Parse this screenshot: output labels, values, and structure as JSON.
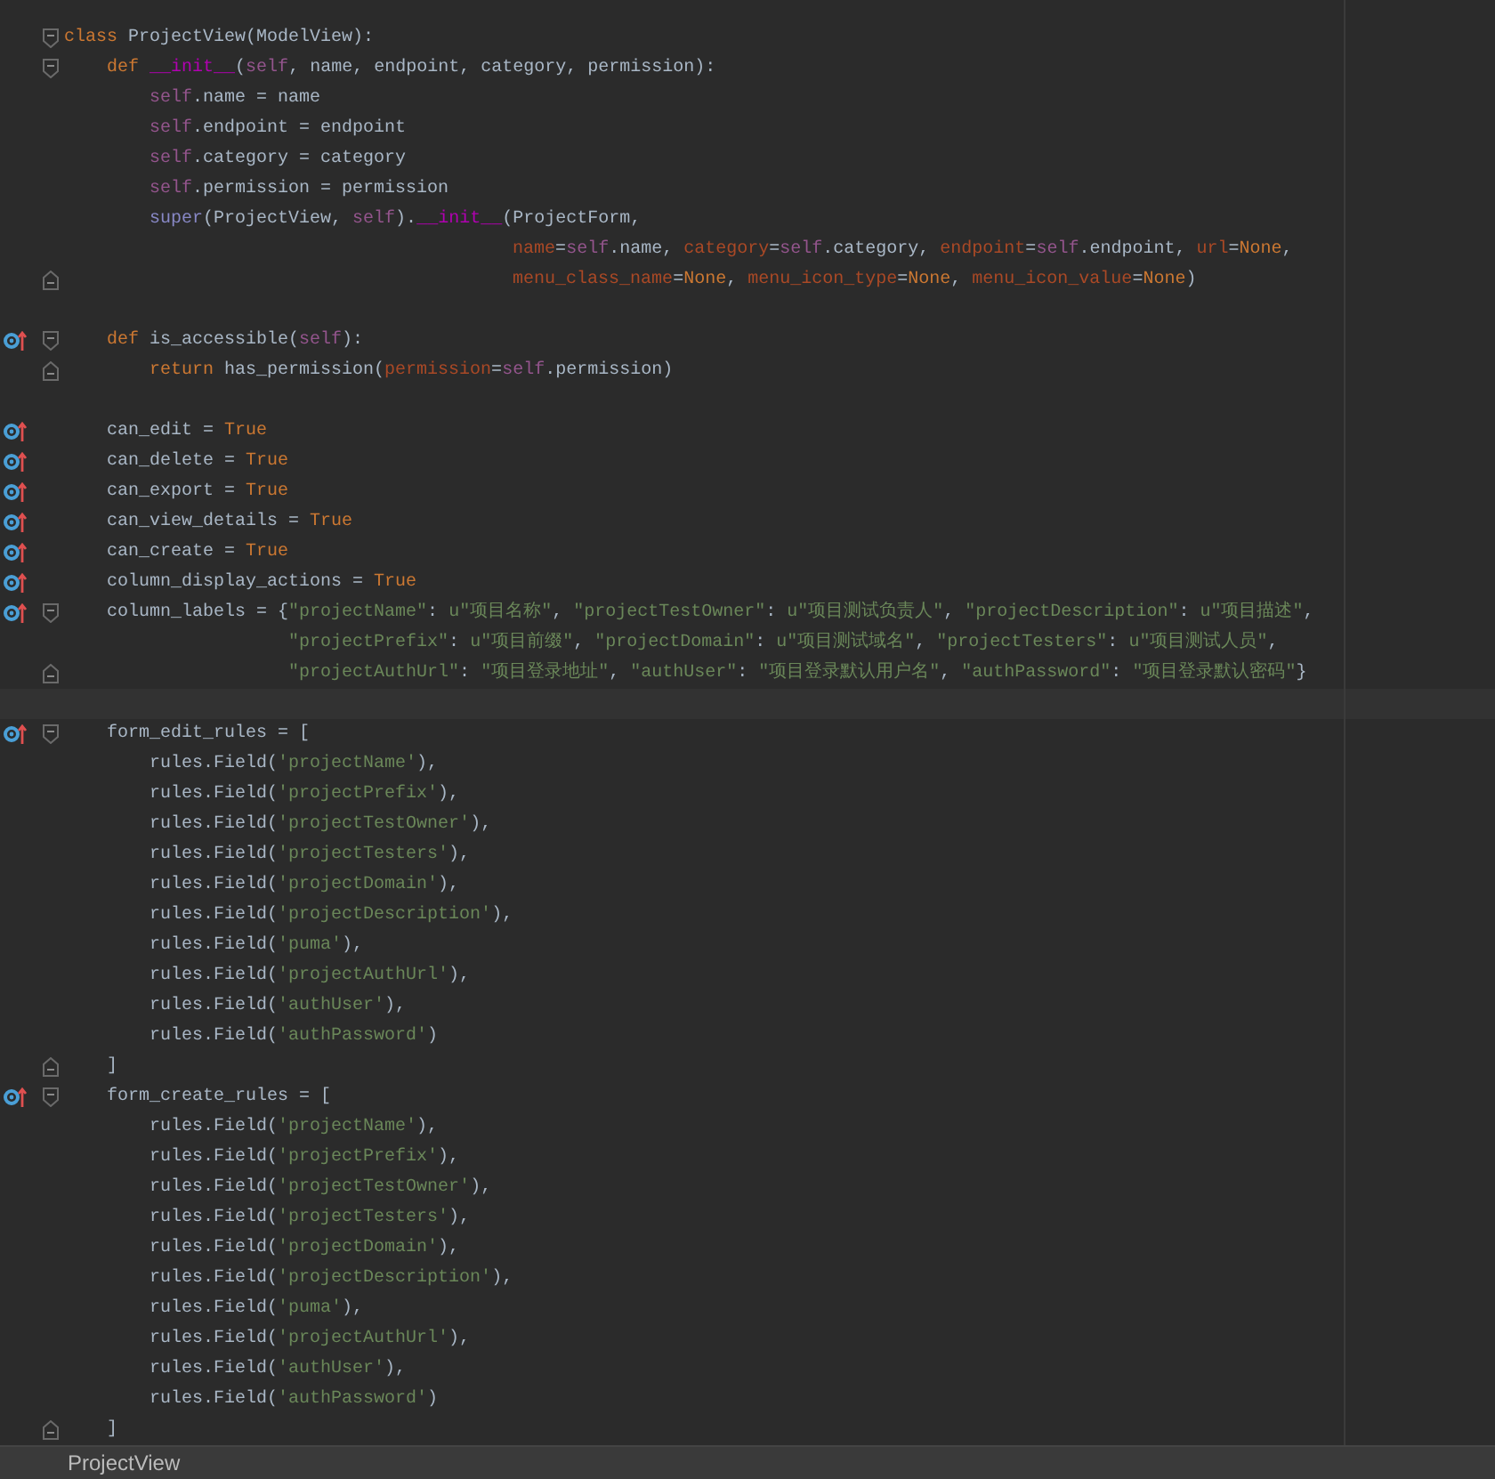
{
  "editor": {
    "lines": [
      {
        "fold_start": true,
        "tokens": [
          {
            "kind": "keyword",
            "text": "class"
          },
          {
            "kind": "plain",
            "text": " ProjectView(ModelView):"
          }
        ]
      },
      {
        "fold_start": true,
        "tokens": [
          {
            "kind": "keyword",
            "text": "    def "
          },
          {
            "kind": "magic",
            "text": "__init__"
          },
          {
            "kind": "plain",
            "text": "("
          },
          {
            "kind": "self",
            "text": "self"
          },
          {
            "kind": "plain",
            "text": ", name, endpoint, category, permission):"
          }
        ]
      },
      {
        "tokens": [
          {
            "kind": "self",
            "text": "        self"
          },
          {
            "kind": "plain",
            "text": ".name = name"
          }
        ]
      },
      {
        "tokens": [
          {
            "kind": "self",
            "text": "        self"
          },
          {
            "kind": "plain",
            "text": ".endpoint = endpoint"
          }
        ]
      },
      {
        "tokens": [
          {
            "kind": "self",
            "text": "        self"
          },
          {
            "kind": "plain",
            "text": ".category = category"
          }
        ]
      },
      {
        "tokens": [
          {
            "kind": "self",
            "text": "        self"
          },
          {
            "kind": "plain",
            "text": ".permission = permission"
          }
        ]
      },
      {
        "tokens": [
          {
            "kind": "builtin",
            "text": "        super"
          },
          {
            "kind": "plain",
            "text": "(ProjectView, "
          },
          {
            "kind": "self",
            "text": "self"
          },
          {
            "kind": "plain",
            "text": ")."
          },
          {
            "kind": "magic",
            "text": "__init__"
          },
          {
            "kind": "plain",
            "text": "(ProjectForm,"
          }
        ]
      },
      {
        "tokens": [
          {
            "kind": "param",
            "text": "                                          name"
          },
          {
            "kind": "plain",
            "text": "="
          },
          {
            "kind": "self",
            "text": "self"
          },
          {
            "kind": "plain",
            "text": ".name, "
          },
          {
            "kind": "param",
            "text": "category"
          },
          {
            "kind": "plain",
            "text": "="
          },
          {
            "kind": "self",
            "text": "self"
          },
          {
            "kind": "plain",
            "text": ".category, "
          },
          {
            "kind": "param",
            "text": "endpoint"
          },
          {
            "kind": "plain",
            "text": "="
          },
          {
            "kind": "self",
            "text": "self"
          },
          {
            "kind": "plain",
            "text": ".endpoint, "
          },
          {
            "kind": "param",
            "text": "url"
          },
          {
            "kind": "plain",
            "text": "="
          },
          {
            "kind": "keyword",
            "text": "None"
          },
          {
            "kind": "plain",
            "text": ","
          }
        ]
      },
      {
        "fold_end": true,
        "tokens": [
          {
            "kind": "param",
            "text": "                                          menu_class_name"
          },
          {
            "kind": "plain",
            "text": "="
          },
          {
            "kind": "keyword",
            "text": "None"
          },
          {
            "kind": "plain",
            "text": ", "
          },
          {
            "kind": "param",
            "text": "menu_icon_type"
          },
          {
            "kind": "plain",
            "text": "="
          },
          {
            "kind": "keyword",
            "text": "None"
          },
          {
            "kind": "plain",
            "text": ", "
          },
          {
            "kind": "param",
            "text": "menu_icon_value"
          },
          {
            "kind": "plain",
            "text": "="
          },
          {
            "kind": "keyword",
            "text": "None"
          },
          {
            "kind": "plain",
            "text": ")"
          }
        ]
      },
      {
        "kind": "blank"
      },
      {
        "override_marker": true,
        "fold_start": true,
        "tokens": [
          {
            "kind": "keyword",
            "text": "    def"
          },
          {
            "kind": "plain",
            "text": " is_accessible("
          },
          {
            "kind": "self",
            "text": "self"
          },
          {
            "kind": "plain",
            "text": "):"
          }
        ]
      },
      {
        "fold_end": true,
        "tokens": [
          {
            "kind": "keyword",
            "text": "        return"
          },
          {
            "kind": "plain",
            "text": " has_permission("
          },
          {
            "kind": "param",
            "text": "permission"
          },
          {
            "kind": "plain",
            "text": "="
          },
          {
            "kind": "self",
            "text": "self"
          },
          {
            "kind": "plain",
            "text": ".permission)"
          }
        ]
      },
      {
        "kind": "blank"
      },
      {
        "override_marker": true,
        "tokens": [
          {
            "kind": "plain",
            "text": "    can_edit = "
          },
          {
            "kind": "keyword",
            "text": "True"
          }
        ]
      },
      {
        "override_marker": true,
        "tokens": [
          {
            "kind": "plain",
            "text": "    can_delete = "
          },
          {
            "kind": "keyword",
            "text": "True"
          }
        ]
      },
      {
        "override_marker": true,
        "tokens": [
          {
            "kind": "plain",
            "text": "    can_export = "
          },
          {
            "kind": "keyword",
            "text": "True"
          }
        ]
      },
      {
        "override_marker": true,
        "tokens": [
          {
            "kind": "plain",
            "text": "    can_view_details = "
          },
          {
            "kind": "keyword",
            "text": "True"
          }
        ]
      },
      {
        "override_marker": true,
        "tokens": [
          {
            "kind": "plain",
            "text": "    can_create = "
          },
          {
            "kind": "keyword",
            "text": "True"
          }
        ]
      },
      {
        "override_marker": true,
        "tokens": [
          {
            "kind": "plain",
            "text": "    column_display_actions = "
          },
          {
            "kind": "keyword",
            "text": "True"
          }
        ]
      },
      {
        "override_marker": true,
        "fold_start": true,
        "tokens": [
          {
            "kind": "plain",
            "text": "    column_labels = {"
          },
          {
            "kind": "string",
            "text": "\"projectName\""
          },
          {
            "kind": "plain",
            "text": ": "
          },
          {
            "kind": "string",
            "text": "u\"项目名称\""
          },
          {
            "kind": "plain",
            "text": ", "
          },
          {
            "kind": "string",
            "text": "\"projectTestOwner\""
          },
          {
            "kind": "plain",
            "text": ": "
          },
          {
            "kind": "string",
            "text": "u\"项目测试负责人\""
          },
          {
            "kind": "plain",
            "text": ", "
          },
          {
            "kind": "string",
            "text": "\"projectDescription\""
          },
          {
            "kind": "plain",
            "text": ": "
          },
          {
            "kind": "string",
            "text": "u\"项目描述\""
          },
          {
            "kind": "plain",
            "text": ","
          }
        ]
      },
      {
        "tokens": [
          {
            "kind": "string",
            "text": "                     \"projectPrefix\""
          },
          {
            "kind": "plain",
            "text": ": "
          },
          {
            "kind": "string",
            "text": "u\"项目前缀\""
          },
          {
            "kind": "plain",
            "text": ", "
          },
          {
            "kind": "string",
            "text": "\"projectDomain\""
          },
          {
            "kind": "plain",
            "text": ": "
          },
          {
            "kind": "string",
            "text": "u\"项目测试域名\""
          },
          {
            "kind": "plain",
            "text": ", "
          },
          {
            "kind": "string",
            "text": "\"projectTesters\""
          },
          {
            "kind": "plain",
            "text": ": "
          },
          {
            "kind": "string",
            "text": "u\"项目测试人员\""
          },
          {
            "kind": "plain",
            "text": ","
          }
        ]
      },
      {
        "fold_end": true,
        "tokens": [
          {
            "kind": "string",
            "text": "                     \"projectAuthUrl\""
          },
          {
            "kind": "plain",
            "text": ": "
          },
          {
            "kind": "string",
            "text": "\"项目登录地址\""
          },
          {
            "kind": "plain",
            "text": ", "
          },
          {
            "kind": "string",
            "text": "\"authUser\""
          },
          {
            "kind": "plain",
            "text": ": "
          },
          {
            "kind": "string",
            "text": "\"项目登录默认用户名\""
          },
          {
            "kind": "plain",
            "text": ", "
          },
          {
            "kind": "string",
            "text": "\"authPassword\""
          },
          {
            "kind": "plain",
            "text": ": "
          },
          {
            "kind": "string",
            "text": "\"项目登录默认密码\""
          },
          {
            "kind": "plain",
            "text": "}"
          }
        ]
      },
      {
        "current": true
      },
      {
        "override_marker": true,
        "fold_start": true,
        "tokens": [
          {
            "kind": "plain",
            "text": "    form_edit_rules = ["
          }
        ]
      },
      {
        "tokens": [
          {
            "kind": "plain",
            "text": "        rules.Field("
          },
          {
            "kind": "string",
            "text": "'projectName'"
          },
          {
            "kind": "plain",
            "text": "),"
          }
        ]
      },
      {
        "tokens": [
          {
            "kind": "plain",
            "text": "        rules.Field("
          },
          {
            "kind": "string",
            "text": "'projectPrefix'"
          },
          {
            "kind": "plain",
            "text": "),"
          }
        ]
      },
      {
        "tokens": [
          {
            "kind": "plain",
            "text": "        rules.Field("
          },
          {
            "kind": "string",
            "text": "'projectTestOwner'"
          },
          {
            "kind": "plain",
            "text": "),"
          }
        ]
      },
      {
        "tokens": [
          {
            "kind": "plain",
            "text": "        rules.Field("
          },
          {
            "kind": "string",
            "text": "'projectTesters'"
          },
          {
            "kind": "plain",
            "text": "),"
          }
        ]
      },
      {
        "tokens": [
          {
            "kind": "plain",
            "text": "        rules.Field("
          },
          {
            "kind": "string",
            "text": "'projectDomain'"
          },
          {
            "kind": "plain",
            "text": "),"
          }
        ]
      },
      {
        "tokens": [
          {
            "kind": "plain",
            "text": "        rules.Field("
          },
          {
            "kind": "string",
            "text": "'projectDescription'"
          },
          {
            "kind": "plain",
            "text": "),"
          }
        ]
      },
      {
        "tokens": [
          {
            "kind": "plain",
            "text": "        rules.Field("
          },
          {
            "kind": "string",
            "text": "'puma'"
          },
          {
            "kind": "plain",
            "text": "),"
          }
        ]
      },
      {
        "tokens": [
          {
            "kind": "plain",
            "text": "        rules.Field("
          },
          {
            "kind": "string",
            "text": "'projectAuthUrl'"
          },
          {
            "kind": "plain",
            "text": "),"
          }
        ]
      },
      {
        "tokens": [
          {
            "kind": "plain",
            "text": "        rules.Field("
          },
          {
            "kind": "string",
            "text": "'authUser'"
          },
          {
            "kind": "plain",
            "text": "),"
          }
        ]
      },
      {
        "tokens": [
          {
            "kind": "plain",
            "text": "        rules.Field("
          },
          {
            "kind": "string",
            "text": "'authPassword'"
          },
          {
            "kind": "plain",
            "text": ")"
          }
        ]
      },
      {
        "fold_end": true,
        "tokens": [
          {
            "kind": "plain",
            "text": "    ]"
          }
        ]
      },
      {
        "override_marker": true,
        "fold_start": true,
        "tokens": [
          {
            "kind": "plain",
            "text": "    form_create_rules = ["
          }
        ]
      },
      {
        "tokens": [
          {
            "kind": "plain",
            "text": "        rules.Field("
          },
          {
            "kind": "string",
            "text": "'projectName'"
          },
          {
            "kind": "plain",
            "text": "),"
          }
        ]
      },
      {
        "tokens": [
          {
            "kind": "plain",
            "text": "        rules.Field("
          },
          {
            "kind": "string",
            "text": "'projectPrefix'"
          },
          {
            "kind": "plain",
            "text": "),"
          }
        ]
      },
      {
        "tokens": [
          {
            "kind": "plain",
            "text": "        rules.Field("
          },
          {
            "kind": "string",
            "text": "'projectTestOwner'"
          },
          {
            "kind": "plain",
            "text": "),"
          }
        ]
      },
      {
        "tokens": [
          {
            "kind": "plain",
            "text": "        rules.Field("
          },
          {
            "kind": "string",
            "text": "'projectTesters'"
          },
          {
            "kind": "plain",
            "text": "),"
          }
        ]
      },
      {
        "tokens": [
          {
            "kind": "plain",
            "text": "        rules.Field("
          },
          {
            "kind": "string",
            "text": "'projectDomain'"
          },
          {
            "kind": "plain",
            "text": "),"
          }
        ]
      },
      {
        "tokens": [
          {
            "kind": "plain",
            "text": "        rules.Field("
          },
          {
            "kind": "string",
            "text": "'projectDescription'"
          },
          {
            "kind": "plain",
            "text": "),"
          }
        ]
      },
      {
        "tokens": [
          {
            "kind": "plain",
            "text": "        rules.Field("
          },
          {
            "kind": "string",
            "text": "'puma'"
          },
          {
            "kind": "plain",
            "text": "),"
          }
        ]
      },
      {
        "tokens": [
          {
            "kind": "plain",
            "text": "        rules.Field("
          },
          {
            "kind": "string",
            "text": "'projectAuthUrl'"
          },
          {
            "kind": "plain",
            "text": "),"
          }
        ]
      },
      {
        "tokens": [
          {
            "kind": "plain",
            "text": "        rules.Field("
          },
          {
            "kind": "string",
            "text": "'authUser'"
          },
          {
            "kind": "plain",
            "text": "),"
          }
        ]
      },
      {
        "tokens": [
          {
            "kind": "plain",
            "text": "        rules.Field("
          },
          {
            "kind": "string",
            "text": "'authPassword'"
          },
          {
            "kind": "plain",
            "text": ")"
          }
        ]
      },
      {
        "fold_end": true,
        "tokens": [
          {
            "kind": "plain",
            "text": "    ]"
          }
        ]
      }
    ]
  },
  "breadcrumb": {
    "text": "ProjectView"
  }
}
